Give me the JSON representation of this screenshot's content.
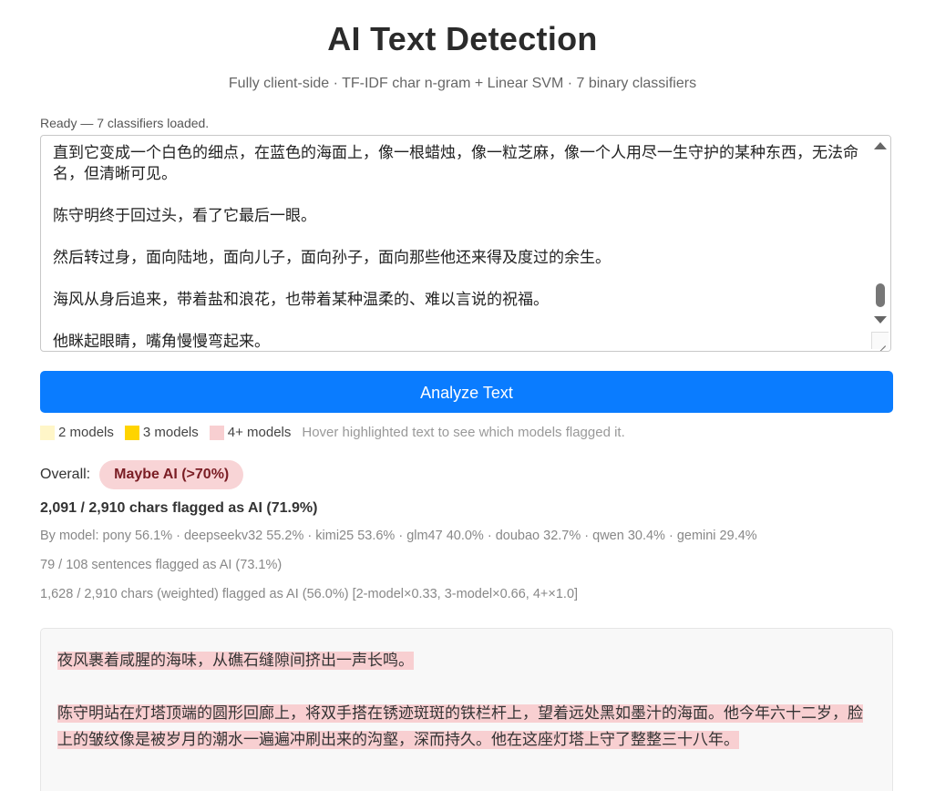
{
  "header": {
    "title": "AI Text Detection",
    "subtitle": "Fully client-side · TF-IDF char n-gram + Linear SVM · 7 binary classifiers"
  },
  "status": "Ready — 7 classifiers loaded.",
  "input": {
    "text": "直到它变成一个白色的细点，在蓝色的海面上，像一根蜡烛，像一粒芝麻，像一个人用尽一生守护的某种东西，无法命名，但清晰可见。\n\n陈守明终于回过头，看了它最后一眼。\n\n然后转过身，面向陆地，面向儿子，面向孙子，面向那些他还来得及度过的余生。\n\n海风从身后追来，带着盐和浪花，也带着某种温柔的、难以言说的祝福。\n\n他眯起眼睛，嘴角慢慢弯起来。"
  },
  "analyze_label": "Analyze Text",
  "legend": {
    "items": [
      {
        "label": "2 models",
        "color": "#fff6c8"
      },
      {
        "label": "3 models",
        "color": "#ffd400"
      },
      {
        "label": "4+ models",
        "color": "#f8cfd1"
      }
    ],
    "hint": "Hover highlighted text to see which models flagged it."
  },
  "overall": {
    "label": "Overall:",
    "verdict": "Maybe AI (>70%)"
  },
  "stats": {
    "chars_flagged": "2,091 / 2,910 chars flagged as AI (71.9%)",
    "by_model": "By model: pony 56.1% · deepseekv32 55.2% · kimi25 53.6% · glm47 40.0% · doubao 32.7% · qwen 30.4% · gemini 29.4%",
    "sentences_flagged": "79 / 108 sentences flagged as AI (73.1%)",
    "weighted": "1,628 / 2,910 chars (weighted) flagged as AI (56.0%) [2-model×0.33, 3-model×0.66, 4+×1.0]"
  },
  "result": {
    "para1": "夜风裹着咸腥的海味，从礁石缝隙间挤出一声长鸣。",
    "para2_s1": "陈守明站在灯塔顶端的圆形回廊上，将双手搭在锈迹斑斑的铁栏杆上，望着远处黑如墨汁的海面。",
    "para2_s2": "他今年六十二岁，脸上的皱纹像是被岁月的潮水一遍遍冲刷出来的沟壑，深而持久。",
    "para2_s3": "他在这座灯塔上守了整整三十八年。"
  }
}
